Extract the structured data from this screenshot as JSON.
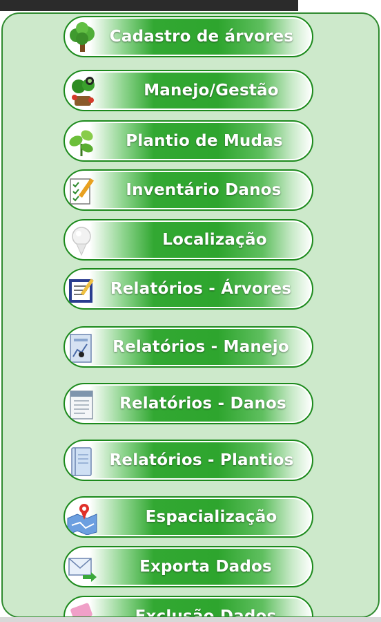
{
  "menu": {
    "items": [
      {
        "label": "Cadastro de árvores",
        "icon": "tree-icon"
      },
      {
        "label": "Manejo/Gestão",
        "icon": "trimmed-tree-icon"
      },
      {
        "label": "Plantio de Mudas",
        "icon": "seedling-icon"
      },
      {
        "label": "Inventário Danos",
        "icon": "checklist-pencil-icon"
      },
      {
        "label": "Localização",
        "icon": "map-pin-icon"
      },
      {
        "label": "Relatórios - Árvores",
        "icon": "report-edit-icon"
      },
      {
        "label": "Relatórios - Manejo",
        "icon": "report-chart-icon"
      },
      {
        "label": "Relatórios - Danos",
        "icon": "document-icon"
      },
      {
        "label": "Relatórios - Plantios",
        "icon": "notebook-icon"
      },
      {
        "label": "Espacialização",
        "icon": "map-icon"
      },
      {
        "label": "Exporta Dados",
        "icon": "email-export-icon"
      },
      {
        "label": "Exclusão Dados",
        "icon": "delete-data-icon"
      }
    ]
  },
  "colors": {
    "panel_background": "#cde9cb",
    "panel_border": "#2f8a2f",
    "button_green": "#2ea52e",
    "button_border": "#1c8a1c",
    "label_text": "#ffffff"
  }
}
